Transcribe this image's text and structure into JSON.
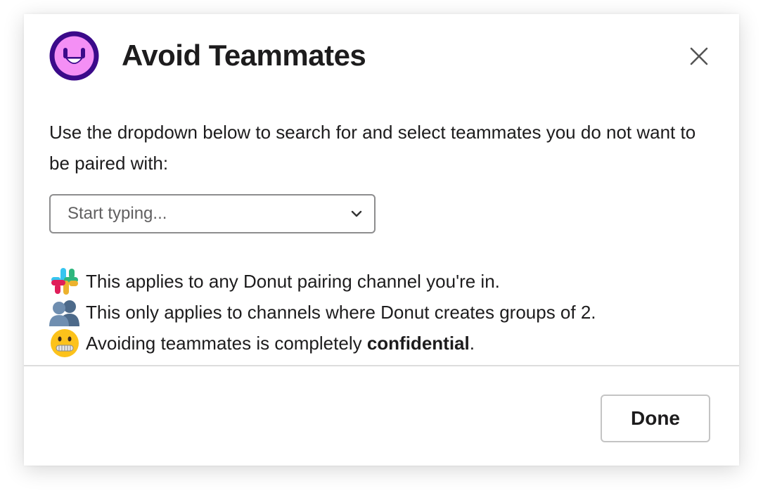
{
  "modal": {
    "title": "Avoid Teammates",
    "description": "Use the dropdown below to search for and select teammates you do not want to be paired with:",
    "select": {
      "placeholder": "Start typing..."
    },
    "notes": [
      {
        "icon": "slack-logo-icon",
        "text": "This applies to any Donut pairing channel you're in."
      },
      {
        "icon": "busts-in-silhouette-icon",
        "text": "This only applies to channels where Donut creates groups of 2."
      },
      {
        "icon": "zipper-mouth-face-icon",
        "text_before": "Avoiding teammates is completely ",
        "text_bold": "confidential",
        "text_after": "."
      }
    ],
    "footer": {
      "done_label": "Done"
    }
  },
  "colors": {
    "avatar_purple": "#3b0a8a",
    "avatar_pink": "#f48ff5",
    "text": "#1d1c1d",
    "border": "#8d8d8e"
  }
}
